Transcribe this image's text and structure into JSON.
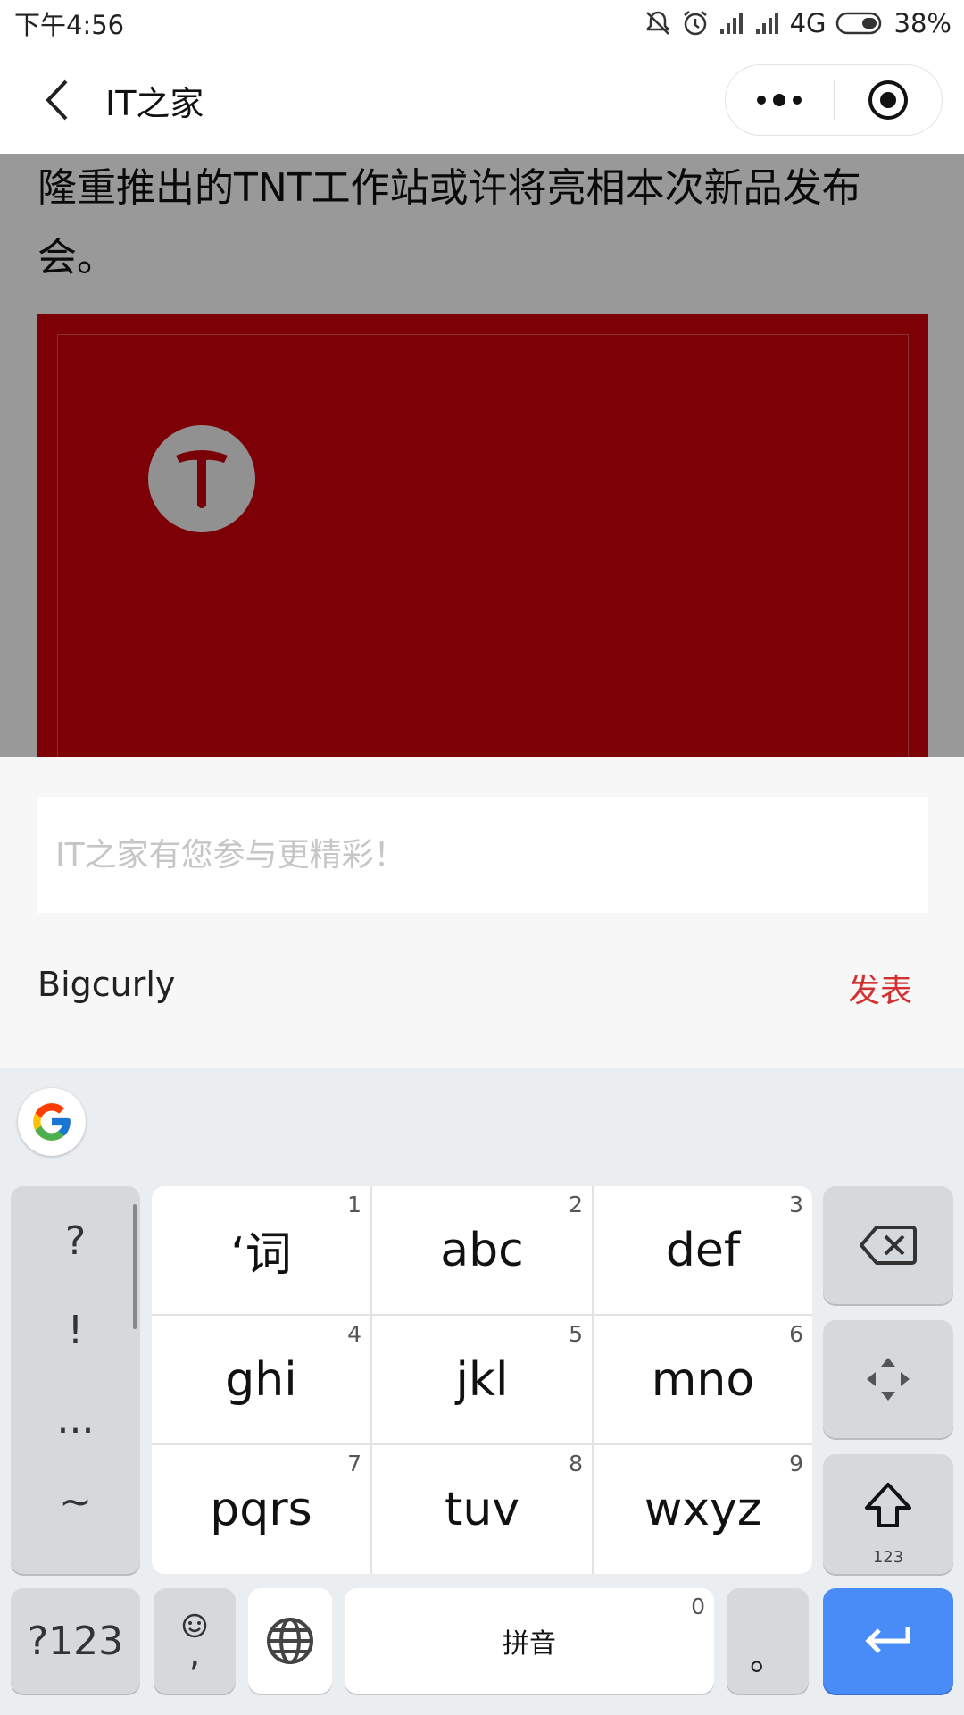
{
  "status_bar": {
    "time": "下午4:56",
    "network": "4G",
    "battery": "38%"
  },
  "nav": {
    "title": "IT之家"
  },
  "article": {
    "text": "隆重推出的TNT工作站或许将亮相本次新品发布会。"
  },
  "comment": {
    "placeholder": "IT之家有您参与更精彩！",
    "username": "Bigcurly",
    "post_label": "发表"
  },
  "keyboard": {
    "punctuation": [
      "?",
      "!",
      "...",
      "~"
    ],
    "keys": [
      {
        "label": "‘词",
        "num": "1"
      },
      {
        "label": "abc",
        "num": "2"
      },
      {
        "label": "def",
        "num": "3"
      },
      {
        "label": "ghi",
        "num": "4"
      },
      {
        "label": "jkl",
        "num": "5"
      },
      {
        "label": "mno",
        "num": "6"
      },
      {
        "label": "pqrs",
        "num": "7"
      },
      {
        "label": "tuv",
        "num": "8"
      },
      {
        "label": "wxyz",
        "num": "9"
      }
    ],
    "symbols_label": "?123",
    "emoji_comma": ",",
    "space_label": "拼音",
    "space_num": "0",
    "period": "。",
    "shift_sub": "123",
    "enter_color": "#4a8cf7"
  },
  "colors": {
    "accent_red": "#d32f2f",
    "image_red": "#d1000a"
  }
}
